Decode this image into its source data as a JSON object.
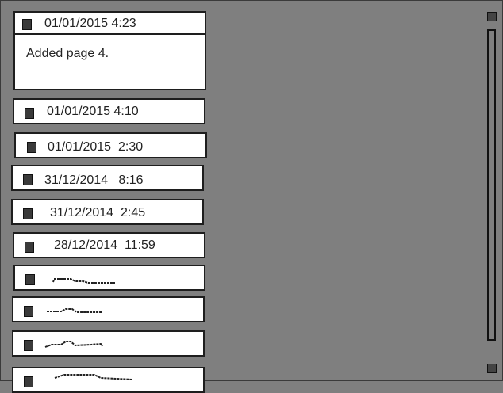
{
  "history": {
    "expanded": {
      "timestamp": "01/01/2015 4:23",
      "detail": "Added page 4."
    },
    "entries": [
      {
        "timestamp": "01/01/2015 4:10"
      },
      {
        "timestamp": "01/01/2015  2:30"
      },
      {
        "timestamp": "31/12/2014   8:16"
      },
      {
        "timestamp": "31/12/2014  2:45"
      },
      {
        "timestamp": "28/12/2014  11:59"
      }
    ]
  },
  "icons": {
    "entry_marker": "square-bullet-icon",
    "scroll_up": "scroll-up-icon",
    "scroll_down": "scroll-down-icon"
  },
  "colors": {
    "background": "#7f7f7f",
    "entry_background": "#ffffff",
    "border": "#1e1e1e",
    "marker": "#3a3a3a"
  }
}
